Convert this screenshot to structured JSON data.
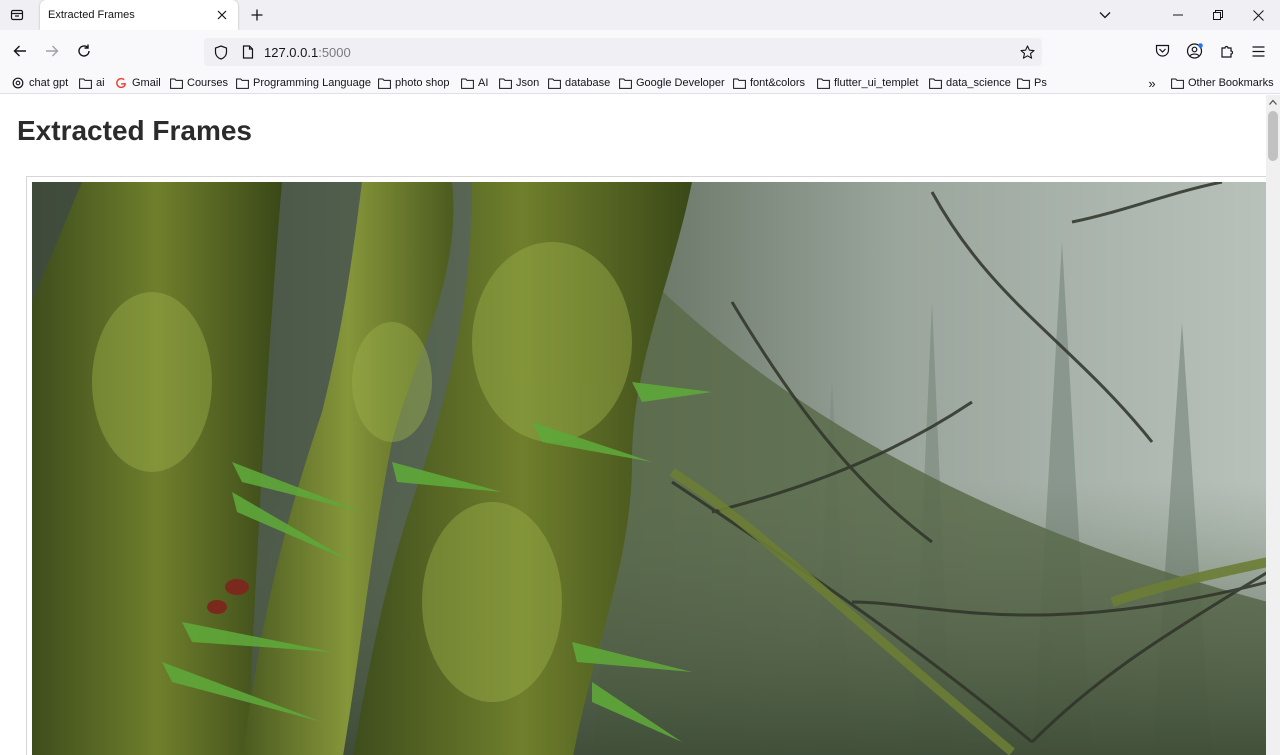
{
  "browser": {
    "tab": {
      "title": "Extracted Frames"
    },
    "url": {
      "host": "127.0.0.1",
      "port": ":5000"
    },
    "bookmarks": [
      {
        "label": "chat gpt",
        "icon": "chatgpt-icon"
      },
      {
        "label": "ai",
        "icon": "folder-icon"
      },
      {
        "label": "Gmail",
        "icon": "google-icon"
      },
      {
        "label": "Courses",
        "icon": "folder-icon"
      },
      {
        "label": "Programming Language",
        "icon": "folder-icon"
      },
      {
        "label": "photo shop",
        "icon": "folder-icon"
      },
      {
        "label": "AI",
        "icon": "folder-icon"
      },
      {
        "label": "Json",
        "icon": "folder-icon"
      },
      {
        "label": "database",
        "icon": "folder-icon"
      },
      {
        "label": "Google Developer",
        "icon": "folder-icon"
      },
      {
        "label": "font&colors",
        "icon": "folder-icon"
      },
      {
        "label": "flutter_ui_templet",
        "icon": "folder-icon"
      },
      {
        "label": "data_science",
        "icon": "folder-icon"
      },
      {
        "label": "Ps",
        "icon": "folder-icon"
      }
    ],
    "other_bookmarks": "Other Bookmarks",
    "overflow": "»"
  },
  "page": {
    "title": "Extracted Frames",
    "frame_image": "forest-moss-frame"
  }
}
